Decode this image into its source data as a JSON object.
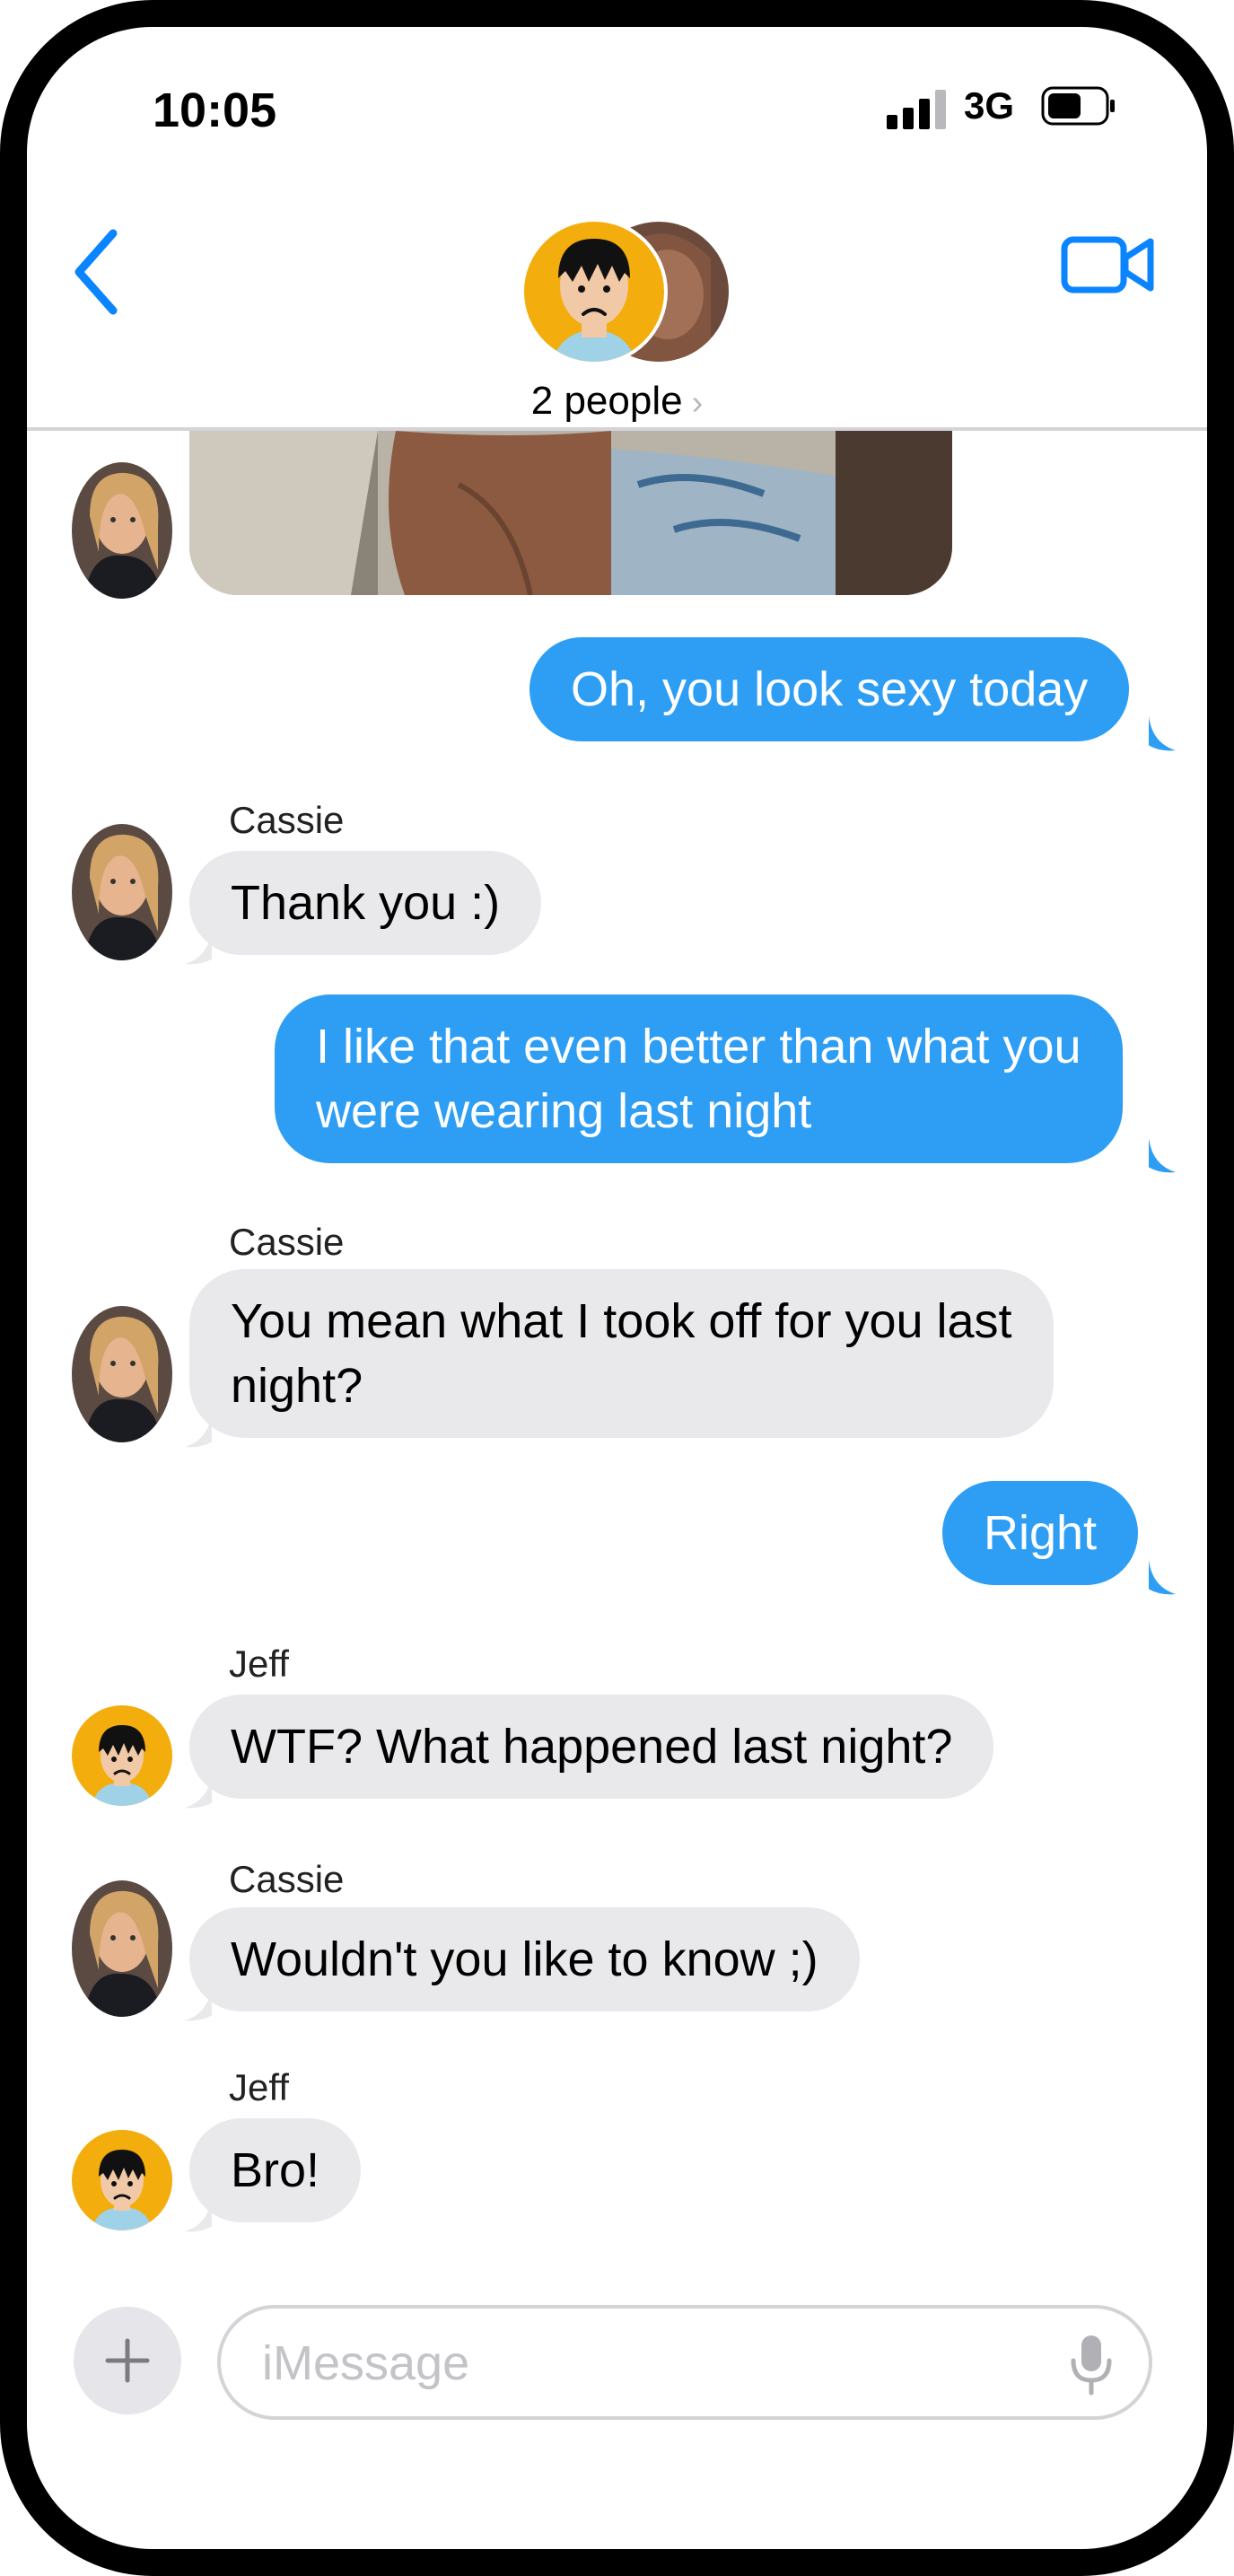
{
  "status_bar": {
    "time": "10:05",
    "network": "3G"
  },
  "header": {
    "title": "2 people",
    "chevron": "›"
  },
  "messages": [
    {
      "type": "incoming-photo",
      "sender_avatar": "cassie"
    },
    {
      "type": "outgoing",
      "text": "Oh, you look sexy today"
    },
    {
      "type": "incoming",
      "sender": "Cassie",
      "text": "Thank you :)"
    },
    {
      "type": "outgoing",
      "lines": [
        "I like that even better than what you",
        "were wearing last night"
      ]
    },
    {
      "type": "incoming",
      "sender": "Cassie",
      "lines": [
        "You mean what I took off for you last",
        "night?"
      ]
    },
    {
      "type": "outgoing",
      "text": "Right"
    },
    {
      "type": "incoming",
      "sender": "Jeff",
      "text": "WTF?  What happened last night?"
    },
    {
      "type": "incoming",
      "sender": "Cassie",
      "text": "Wouldn't you like to know ;)"
    },
    {
      "type": "incoming",
      "sender": "Jeff",
      "text": "Bro!"
    }
  ],
  "composer": {
    "placeholder": "iMessage"
  },
  "icons": [
    "back-chevron-icon",
    "video-camera-icon",
    "plus-icon",
    "microphone-icon",
    "signal-icon",
    "battery-icon"
  ],
  "colors": {
    "accent": "#0a84ff",
    "outgoing_bubble": "#2d9ef4",
    "incoming_bubble": "#e9e9eb",
    "jeff_avatar": "#f3ad0c"
  }
}
